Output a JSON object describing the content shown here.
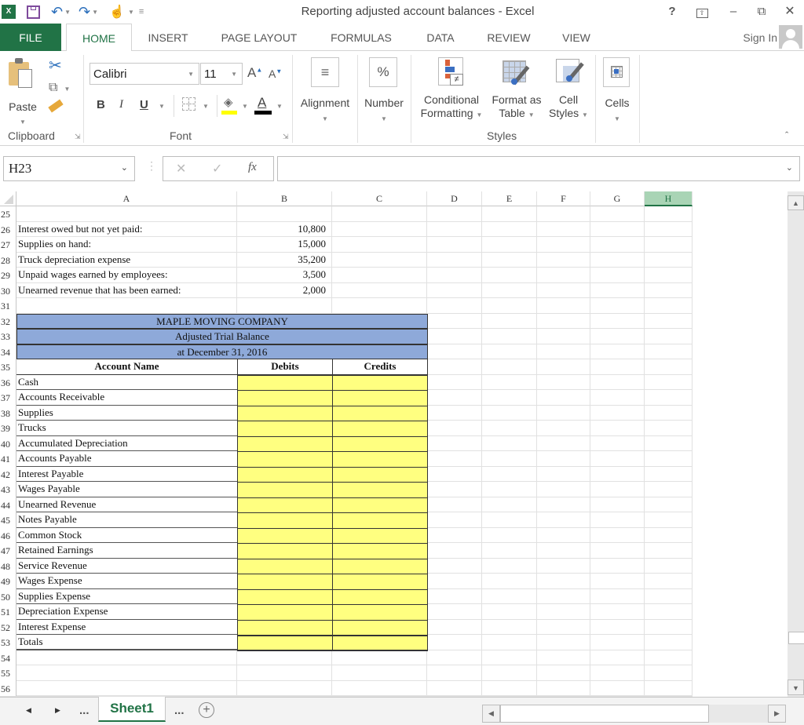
{
  "window": {
    "title": "Reporting adjusted account balances - Excel",
    "help": "?",
    "ribbon_display": "⊞",
    "minimize": "–",
    "restore": "⧉",
    "close": "✕"
  },
  "quick_access": {
    "icons": [
      "excel-logo-icon",
      "save-icon",
      "undo-icon",
      "redo-icon",
      "touch-mode-icon",
      "customize-icon"
    ]
  },
  "tabs": [
    {
      "label": "FILE"
    },
    {
      "label": "HOME",
      "active": true
    },
    {
      "label": "INSERT"
    },
    {
      "label": "PAGE LAYOUT"
    },
    {
      "label": "FORMULAS"
    },
    {
      "label": "DATA"
    },
    {
      "label": "REVIEW"
    },
    {
      "label": "VIEW"
    }
  ],
  "sign_in": "Sign In",
  "ribbon": {
    "clipboard": {
      "paste": "Paste",
      "group": "Clipboard"
    },
    "font": {
      "name": "Calibri",
      "size": "11",
      "bold": "B",
      "italic": "I",
      "underline": "U",
      "grow": "A",
      "shrink": "A",
      "font_color": "A",
      "group": "Font",
      "fill_color": "#ffff00",
      "text_color": "#000000"
    },
    "alignment": {
      "label": "Alignment",
      "icon": "≡"
    },
    "number": {
      "label": "Number",
      "icon": "%"
    },
    "styles": {
      "conditional": [
        "Conditional",
        "Formatting"
      ],
      "format_table": [
        "Format as",
        "Table"
      ],
      "cell_styles": [
        "Cell",
        "Styles"
      ],
      "group": "Styles"
    },
    "cells": {
      "label": "Cells"
    }
  },
  "formula_bar": {
    "name_box": "H23",
    "cancel": "✕",
    "enter": "✓",
    "fx": "fx",
    "value": ""
  },
  "grid": {
    "columns": [
      "A",
      "B",
      "C",
      "D",
      "E",
      "F",
      "G",
      "H"
    ],
    "selected_column": "H",
    "rows": [
      "25",
      "26",
      "27",
      "28",
      "29",
      "30",
      "31",
      "32",
      "33",
      "34",
      "35",
      "36",
      "37",
      "38",
      "39",
      "40",
      "41",
      "42",
      "43",
      "44",
      "45",
      "46",
      "47",
      "48",
      "49",
      "50",
      "51",
      "52",
      "53",
      "54",
      "55",
      "56"
    ],
    "info_rows": [
      {
        "label": "Interest owed but not yet paid:",
        "value": "10,800"
      },
      {
        "label": "Supplies on hand:",
        "value": "15,000"
      },
      {
        "label": "Truck depreciation expense",
        "value": "35,200"
      },
      {
        "label": "Unpaid wages earned by employees:",
        "value": "3,500"
      },
      {
        "label": "Unearned revenue that has been earned:",
        "value": "2,000"
      }
    ],
    "trial_balance": {
      "company": "MAPLE MOVING COMPANY",
      "title": "Adjusted Trial Balance",
      "date": "at December 31, 2016",
      "headers": {
        "account": "Account Name",
        "debits": "Debits",
        "credits": "Credits"
      },
      "accounts": [
        "Cash",
        "Accounts Receivable",
        "Supplies",
        "Trucks",
        "Accumulated Depreciation",
        "Accounts Payable",
        "Interest Payable",
        "Wages Payable",
        "Unearned Revenue",
        "Notes Payable",
        "Common Stock",
        "Retained Earnings",
        "Service Revenue",
        "Wages Expense",
        "Supplies Expense",
        "Depreciation Expense",
        "Interest Expense",
        "Totals"
      ],
      "header_fill": "#8ea9d9",
      "input_fill": "#ffff80"
    }
  },
  "sheet_tabs": {
    "prev": "◀",
    "next": "▶",
    "more_left": "...",
    "active": "Sheet1",
    "more_right": "...",
    "add": "+"
  }
}
